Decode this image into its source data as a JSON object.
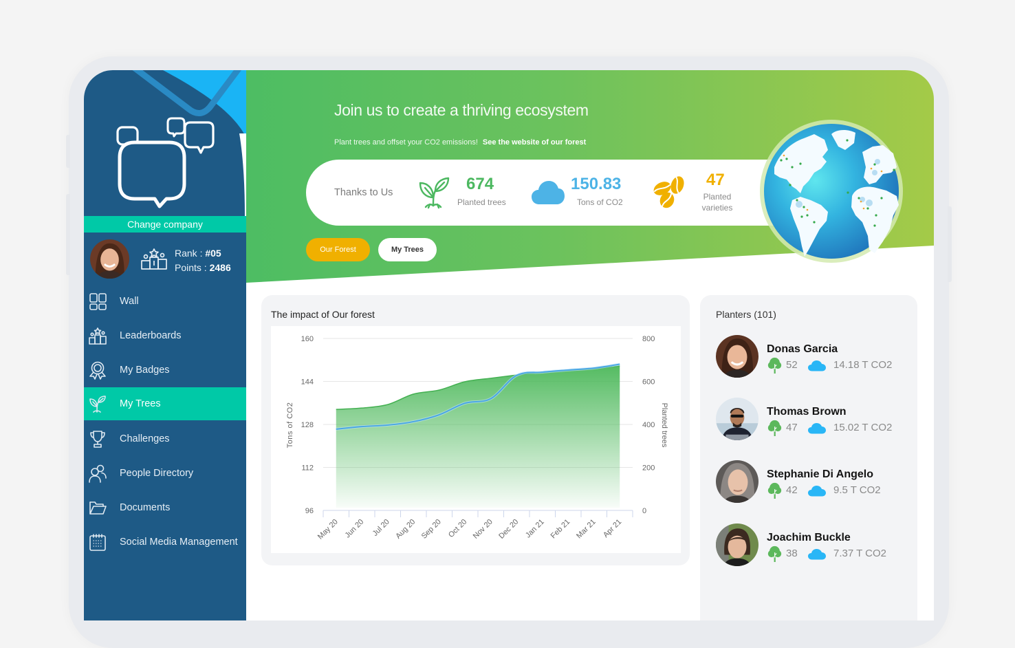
{
  "sidebar": {
    "change_company": "Change company",
    "profile": {
      "rank_label": "Rank  :",
      "rank_value": "#05",
      "points_label": "Points :",
      "points_value": "2486"
    },
    "nav": [
      {
        "label": "Wall",
        "icon": "grid-icon",
        "active": false
      },
      {
        "label": "Leaderboards",
        "icon": "podium-icon",
        "active": false
      },
      {
        "label": "My Badges",
        "icon": "badge-icon",
        "active": false
      },
      {
        "label": "My Trees",
        "icon": "sprout-icon",
        "active": true
      },
      {
        "label": "Challenges",
        "icon": "trophy-icon",
        "active": false
      },
      {
        "label": "People Directory",
        "icon": "people-icon",
        "active": false
      },
      {
        "label": "Documents",
        "icon": "folder-icon",
        "active": false
      },
      {
        "label": "Social Media Management",
        "icon": "calendar-icon",
        "active": false
      }
    ]
  },
  "banner": {
    "title": "Join us to create a thriving ecosystem",
    "subtitle": "Plant trees and offset your CO2 emissions!",
    "link": "See the website of our forest",
    "stats": {
      "intro": "Thanks to Us",
      "items": [
        {
          "value": "674",
          "label": "Planted trees",
          "icon": "sprout-icon",
          "color": "#4cb860"
        },
        {
          "value": "150.83",
          "label": "Tons of CO2",
          "icon": "cloud-icon",
          "color": "#4db3e6"
        },
        {
          "value": "47",
          "label": "Planted varieties",
          "icon": "coffee-beans-icon",
          "color": "#f0b000"
        }
      ]
    },
    "tabs": [
      {
        "label": "Our Forest",
        "active": true
      },
      {
        "label": "My Trees",
        "active": false
      }
    ]
  },
  "impact": {
    "title": "The impact of Our forest"
  },
  "chart_data": {
    "type": "area",
    "title": "The impact of Our forest",
    "categories": [
      "May 20",
      "Jun 20",
      "Jul 20",
      "Aug 20",
      "Sep 20",
      "Oct 20",
      "Nov 20",
      "Dec 20",
      "Jan 21",
      "Feb 21",
      "Mar 21",
      "Apr 21"
    ],
    "series": [
      {
        "name": "Tons of CO2",
        "type": "area",
        "axis": "left",
        "color": "#55bb5f",
        "values": [
          133.6,
          134.1,
          135.4,
          139.3,
          140.8,
          143.9,
          145.2,
          146.4,
          147.5,
          148.2,
          148.7,
          149.8
        ]
      },
      {
        "name": "Planted trees",
        "type": "line",
        "axis": "right",
        "color": "#49a7e3",
        "values": [
          378,
          390,
          397,
          413,
          445,
          499,
          520,
          628,
          643,
          653,
          662,
          680
        ]
      }
    ],
    "y_left": {
      "label": "Tons of CO2",
      "min": 96,
      "max": 160,
      "ticks": [
        96,
        112,
        128,
        144,
        160
      ]
    },
    "y_right": {
      "label": "Planted trees",
      "min": 0,
      "max": 800,
      "ticks": [
        0,
        200,
        400,
        600,
        800
      ]
    },
    "xlabel": "",
    "grid": true,
    "legend": "none"
  },
  "planters": {
    "title": "Planters (101)",
    "items": [
      {
        "name": "Donas Garcia",
        "trees": "52",
        "co2": "14.18 T CO2"
      },
      {
        "name": "Thomas Brown",
        "trees": "47",
        "co2": "15.02 T CO2"
      },
      {
        "name": "Stephanie Di Angelo",
        "trees": "42",
        "co2": "9.5 T CO2"
      },
      {
        "name": "Joachim Buckle",
        "trees": "38",
        "co2": "7.37 T CO2"
      }
    ]
  },
  "colors": {
    "sidebar": "#1e5a86",
    "accent_teal": "#00c9a7",
    "tree_green": "#4cb860",
    "co2_blue": "#4db3e6",
    "varieties_orange": "#f0b000"
  }
}
